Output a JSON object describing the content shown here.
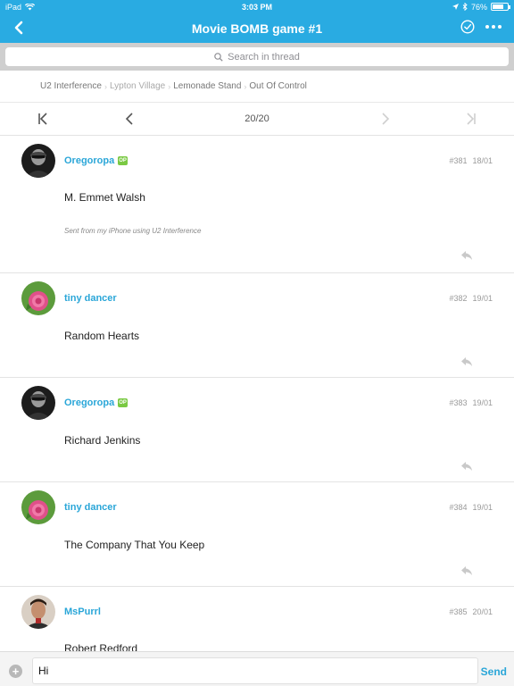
{
  "status_bar": {
    "device": "iPad",
    "time": "3:03 PM",
    "battery": "76%",
    "battery_level": 0.76
  },
  "nav": {
    "title": "Movie BOMB game #1",
    "back_icon": "chevron-left-icon",
    "check_icon": "check-circle-icon",
    "more_icon": "more-dots-icon"
  },
  "search": {
    "placeholder": "Search in thread"
  },
  "breadcrumb": [
    "U2 Interference",
    "Lypton Village",
    "Lemonade Stand",
    "Out Of Control"
  ],
  "pager": {
    "label": "20/20"
  },
  "posts": [
    {
      "author": "Oregoropa",
      "op": "OP",
      "number": "#381",
      "date": "18/01",
      "text": "M. Emmet Walsh",
      "signature": "Sent from my iPhone using U2 Interference"
    },
    {
      "author": "tiny dancer",
      "op": "",
      "number": "#382",
      "date": "19/01",
      "text": "Random Hearts",
      "signature": ""
    },
    {
      "author": "Oregoropa",
      "op": "OP",
      "number": "#383",
      "date": "19/01",
      "text": "Richard Jenkins",
      "signature": ""
    },
    {
      "author": "tiny dancer",
      "op": "",
      "number": "#384",
      "date": "19/01",
      "text": "The Company That You Keep",
      "signature": ""
    },
    {
      "author": "MsPurrl",
      "op": "",
      "number": "#385",
      "date": "20/01",
      "text": "Robert Redford",
      "signature": ""
    }
  ],
  "composer": {
    "value": "Hi",
    "send_label": "Send"
  },
  "colors": {
    "accent": "#29abe2",
    "op_badge": "#7ac943",
    "username": "#2aa6d8"
  }
}
